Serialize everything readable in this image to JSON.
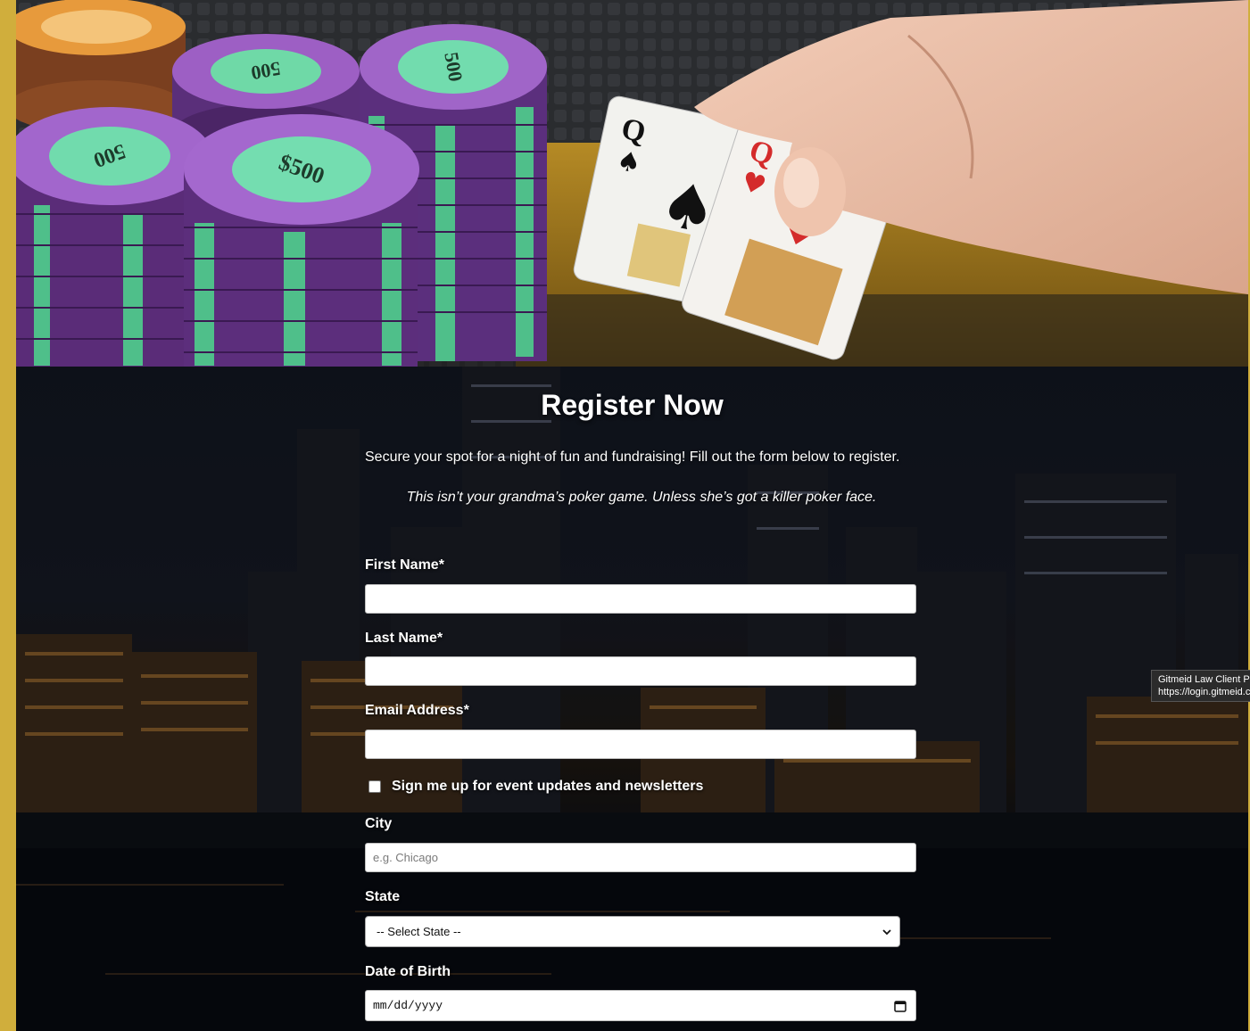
{
  "hero": {
    "chip_value_labels": [
      "$500",
      "$500",
      "$500",
      "$500"
    ],
    "card_ranks": [
      "Q",
      "Q"
    ]
  },
  "registration": {
    "title": "Register Now",
    "intro": "Secure your spot for a night of fun and fundraising! Fill out the form below to register.",
    "tagline": "This isn’t your grandma’s poker game. Unless she’s got a killer poker face."
  },
  "form": {
    "first_name": {
      "label": "First Name*",
      "value": ""
    },
    "last_name": {
      "label": "Last Name*",
      "value": ""
    },
    "email": {
      "label": "Email Address*",
      "value": ""
    },
    "newsletter": {
      "label": "Sign me up for event updates and newsletters",
      "checked": false
    },
    "city": {
      "label": "City",
      "placeholder": "e.g. Chicago",
      "value": ""
    },
    "state": {
      "label": "State",
      "selected": "-- Select State --"
    },
    "dob": {
      "label": "Date of Birth",
      "placeholder": "mm/dd/yyyy"
    }
  },
  "tooltip": {
    "line1": "Gitmeid Law Client Portal",
    "line2": "https://login.gitmeid.com"
  },
  "colors": {
    "gold_border": "#d0ae3c",
    "chip_purple": "#9d5fc4",
    "chip_green": "#6fd9a7",
    "chip_pink": "#f08ad0"
  },
  "icons": {
    "state_select": "chevron-down-icon",
    "dob": "calendar-icon"
  }
}
